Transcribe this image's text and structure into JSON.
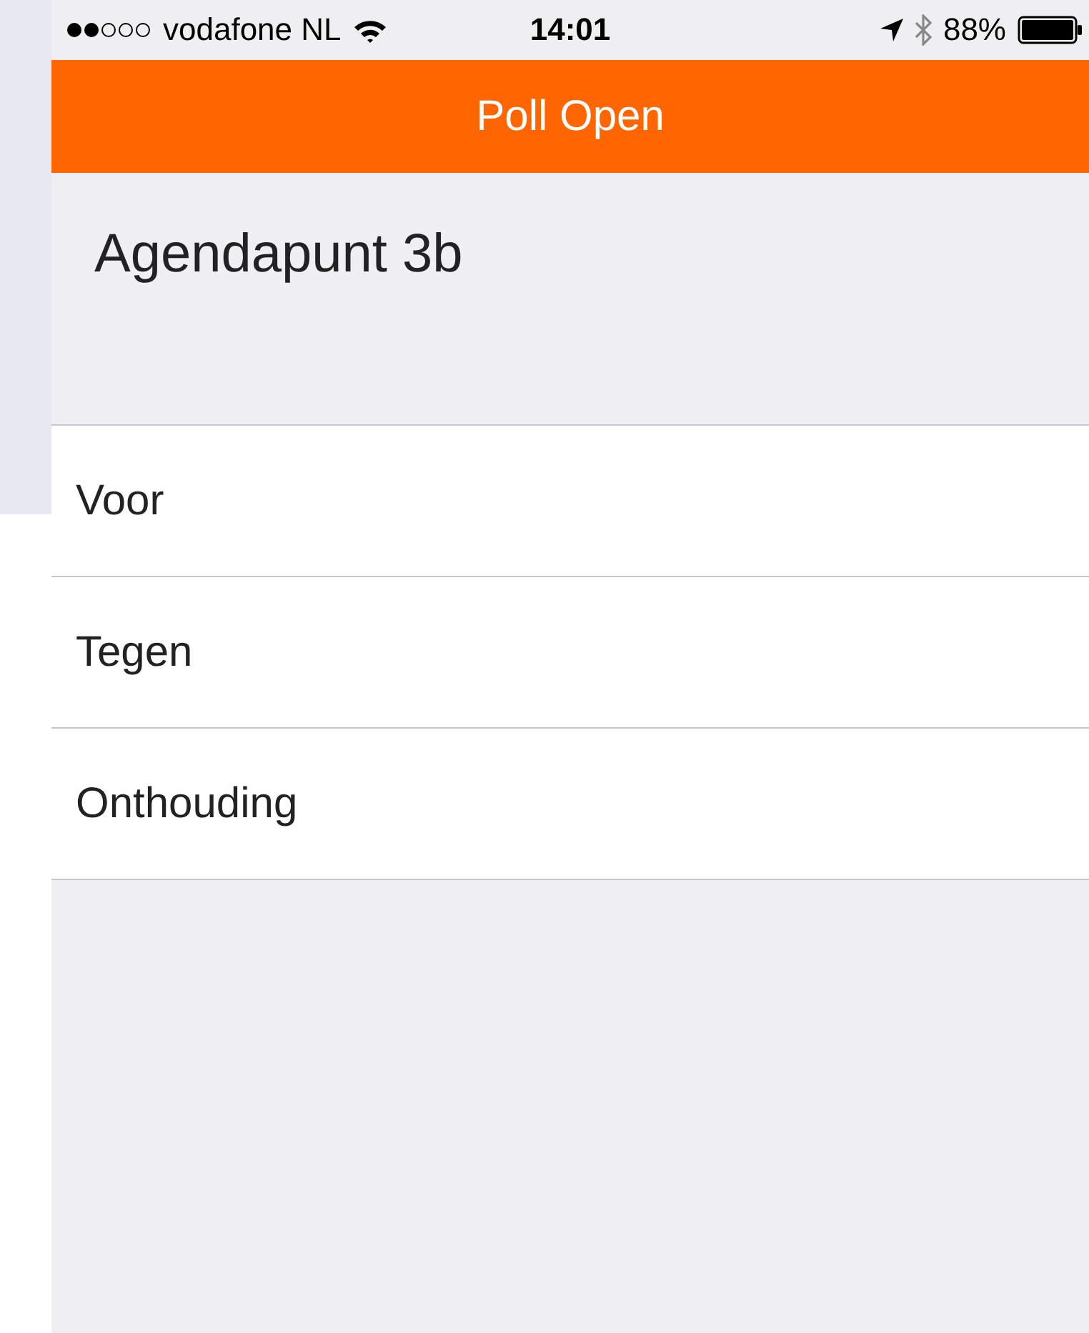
{
  "status_bar": {
    "carrier": "vodafone NL",
    "time": "14:01",
    "battery": "88%"
  },
  "nav_bar": {
    "title": "Poll Open"
  },
  "header": {
    "title": "Agendapunt 3b"
  },
  "options": [
    {
      "label": "Voor"
    },
    {
      "label": "Tegen"
    },
    {
      "label": "Onthouding"
    }
  ]
}
